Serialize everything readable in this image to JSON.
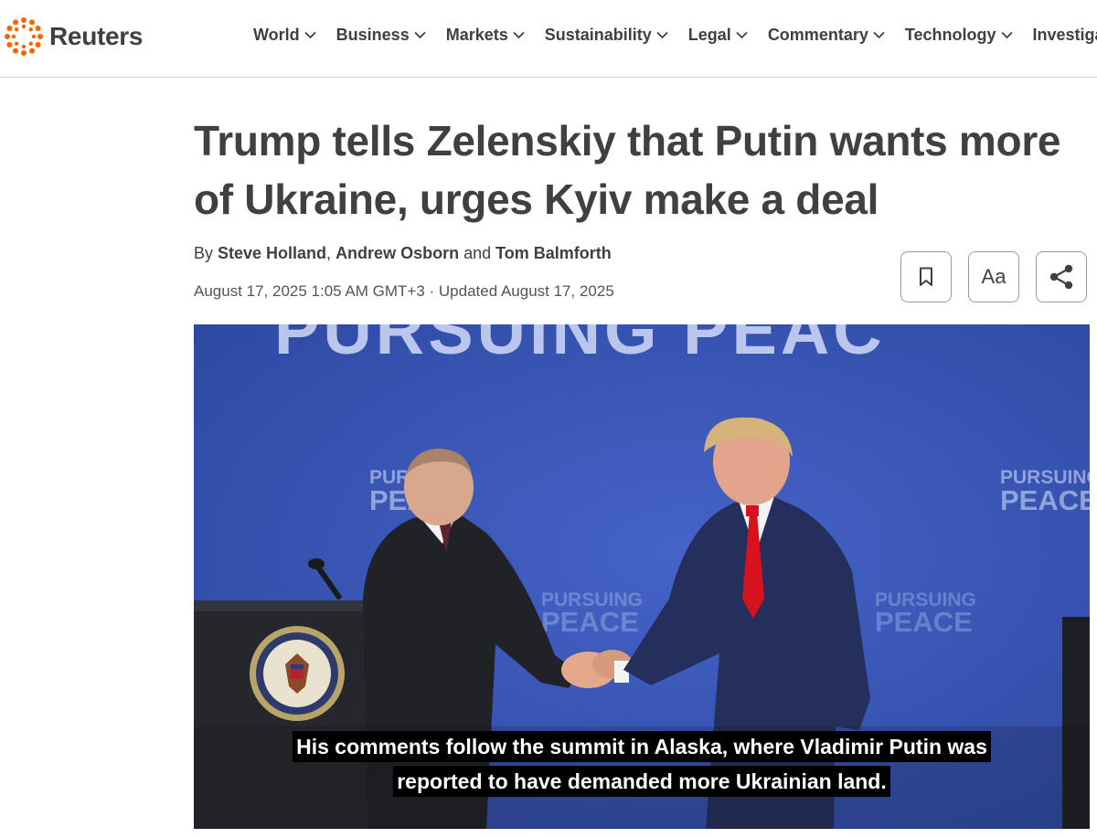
{
  "brand": {
    "name": "Reuters",
    "accent": "#fa6400"
  },
  "nav": {
    "items": [
      {
        "label": "World"
      },
      {
        "label": "Business"
      },
      {
        "label": "Markets"
      },
      {
        "label": "Sustainability"
      },
      {
        "label": "Legal"
      },
      {
        "label": "Commentary"
      },
      {
        "label": "Technology"
      },
      {
        "label": "Investigat"
      }
    ]
  },
  "article": {
    "headline": "Trump tells Zelenskiy that Putin wants more of Ukraine, urges Kyiv make a deal",
    "byline_prefix": "By ",
    "authors": [
      "Steve Holland",
      "Andrew Osborn",
      "Tom Balmforth"
    ],
    "byline_sep": ", ",
    "byline_and": " and ",
    "dateline": "August 17, 2025 1:05 AM GMT+3 · Updated August 17, 2025"
  },
  "tools": {
    "bookmark_icon": "bookmark-icon",
    "text_size_label": "Aa",
    "share_icon": "share-icon"
  },
  "video": {
    "backdrop_text_large": "PURSUING PEAC",
    "backdrop_logo_line1": "PURSUING",
    "backdrop_logo_line2": "PEACE",
    "caption_lines": [
      "His comments follow the summit in Alaska, where Vladimir Putin was",
      "reported to have demanded more Ukrainian land."
    ]
  }
}
